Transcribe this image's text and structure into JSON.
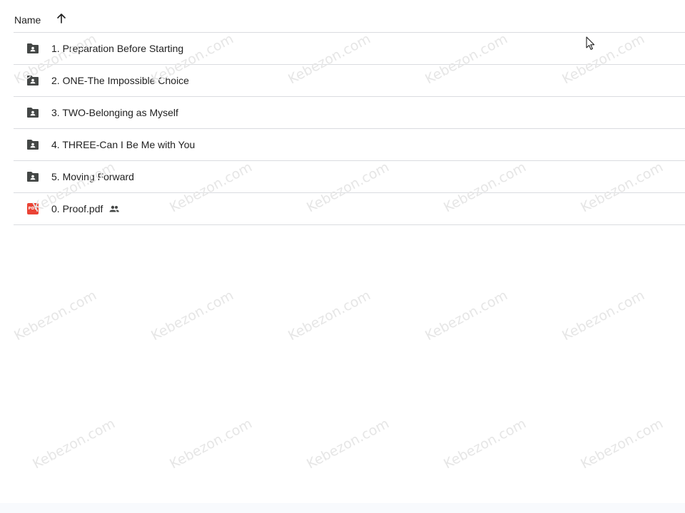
{
  "header": {
    "name_label": "Name",
    "sort_icon": "arrow-up-icon"
  },
  "files": [
    {
      "name": "1. Preparation Before Starting",
      "icon": "shared-folder-icon",
      "shared": false
    },
    {
      "name": "2. ONE-The Impossible Choice",
      "icon": "shared-folder-icon",
      "shared": false
    },
    {
      "name": "3. TWO-Belonging as Myself",
      "icon": "shared-folder-icon",
      "shared": false
    },
    {
      "name": "4. THREE-Can I Be Me with You",
      "icon": "shared-folder-icon",
      "shared": false
    },
    {
      "name": "5. Moving Forward",
      "icon": "shared-folder-icon",
      "shared": false
    },
    {
      "name": "0. Proof.pdf",
      "icon": "pdf-icon",
      "shared": true,
      "badge": "PDF"
    }
  ],
  "watermark": "Kebezon.com",
  "colors": {
    "folder": "#444746",
    "pdf": "#ea4335",
    "divider": "#dadce0"
  }
}
